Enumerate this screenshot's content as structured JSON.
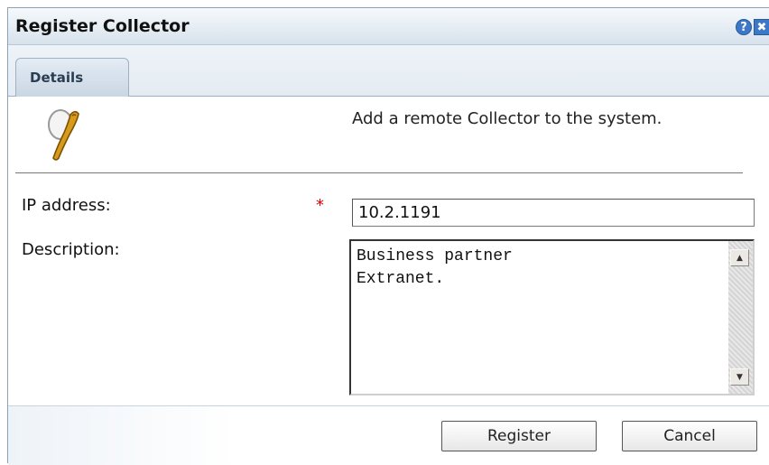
{
  "dialog": {
    "title": "Register Collector",
    "help_glyph": "?",
    "close_glyph": "✖"
  },
  "tabs": [
    {
      "label": "Details",
      "active": true
    }
  ],
  "intro": {
    "icon": "collector-net-icon",
    "text": "Add a remote Collector to the system."
  },
  "form": {
    "ip_label": "IP address:",
    "required_marker": "*",
    "ip_value": "10.2.1191",
    "description_label": "Description:",
    "description_value": "Business partner\nExtranet."
  },
  "buttons": {
    "register_label": "Register",
    "cancel_label": "Cancel"
  },
  "colors": {
    "required": "#e00000",
    "titlebar_accent": "#3c78c8"
  }
}
